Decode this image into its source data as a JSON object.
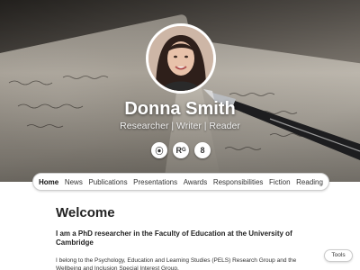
{
  "profile": {
    "name": "Donna Smith",
    "tagline": "Researcher | Writer | Reader"
  },
  "social": [
    {
      "icon": "orcid-icon",
      "glyph": "⦿"
    },
    {
      "icon": "researchgate-icon",
      "glyph": "Rᴳ"
    },
    {
      "icon": "google-scholar-icon",
      "glyph": "8"
    }
  ],
  "nav": {
    "items": [
      "Home",
      "News",
      "Publications",
      "Presentations",
      "Awards",
      "Responsibilities",
      "Fiction",
      "Reading"
    ],
    "active": "Home"
  },
  "main": {
    "heading": "Welcome",
    "intro": "I am a PhD researcher in the Faculty of Education at the University of Cambridge",
    "body": "I belong to the Psychology, Education and Learning Studies (PELS) Research Group and the Wellbeing and Inclusion Special Interest Group."
  },
  "tools_label": "Tools"
}
